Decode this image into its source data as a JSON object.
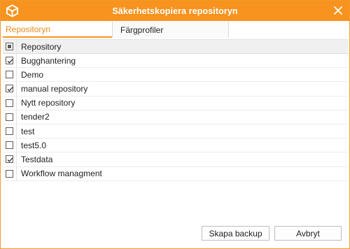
{
  "window": {
    "title": "Säkerhetskopiera repositoryn"
  },
  "tabs": [
    {
      "label": "Repositoryn",
      "active": true
    },
    {
      "label": "Färgprofiler",
      "active": false
    }
  ],
  "table": {
    "header": "Repository",
    "rows": [
      {
        "name": "Bugghantering",
        "checked": true
      },
      {
        "name": "Demo",
        "checked": false
      },
      {
        "name": "manual repository",
        "checked": true
      },
      {
        "name": "Nytt repository",
        "checked": false
      },
      {
        "name": "tender2",
        "checked": false
      },
      {
        "name": "test",
        "checked": false
      },
      {
        "name": "test5.0",
        "checked": false
      },
      {
        "name": "Testdata",
        "checked": true
      },
      {
        "name": "Workflow managment",
        "checked": false
      }
    ]
  },
  "buttons": {
    "backup": "Skapa backup",
    "cancel": "Avbryt"
  },
  "colors": {
    "accent": "#f7931e",
    "tab_active_text": "#f08a1c"
  },
  "icons": {
    "app": "cube-icon",
    "close": "close-icon"
  }
}
